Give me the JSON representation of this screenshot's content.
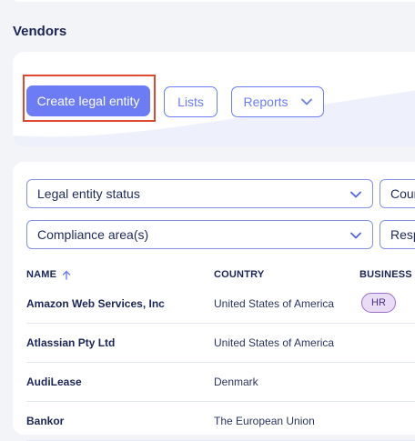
{
  "page": {
    "title": "Vendors"
  },
  "actions": {
    "create_label": "Create legal entity",
    "lists_label": "Lists",
    "reports_label": "Reports"
  },
  "filters": {
    "status": "Legal entity status",
    "country": "Coun",
    "compliance": "Compliance area(s)",
    "responsible": "Resp"
  },
  "table": {
    "columns": {
      "name": "NAME",
      "country": "COUNTRY",
      "business": "BUSINESS A"
    },
    "rows": [
      {
        "name": "Amazon Web Services, Inc",
        "country": "United States of America",
        "badge": "HR"
      },
      {
        "name": "Atlassian Pty Ltd",
        "country": "United States of America",
        "badge": ""
      },
      {
        "name": "AudiLease",
        "country": "Denmark",
        "badge": ""
      },
      {
        "name": "Bankor",
        "country": "The European Union",
        "badge": ""
      }
    ]
  },
  "colors": {
    "accent": "#6b7cf4",
    "highlight": "#e0482f",
    "badge_bg": "#eadcf5"
  },
  "icons": [
    "chevron-down-icon",
    "sort-arrow-up-icon"
  ]
}
